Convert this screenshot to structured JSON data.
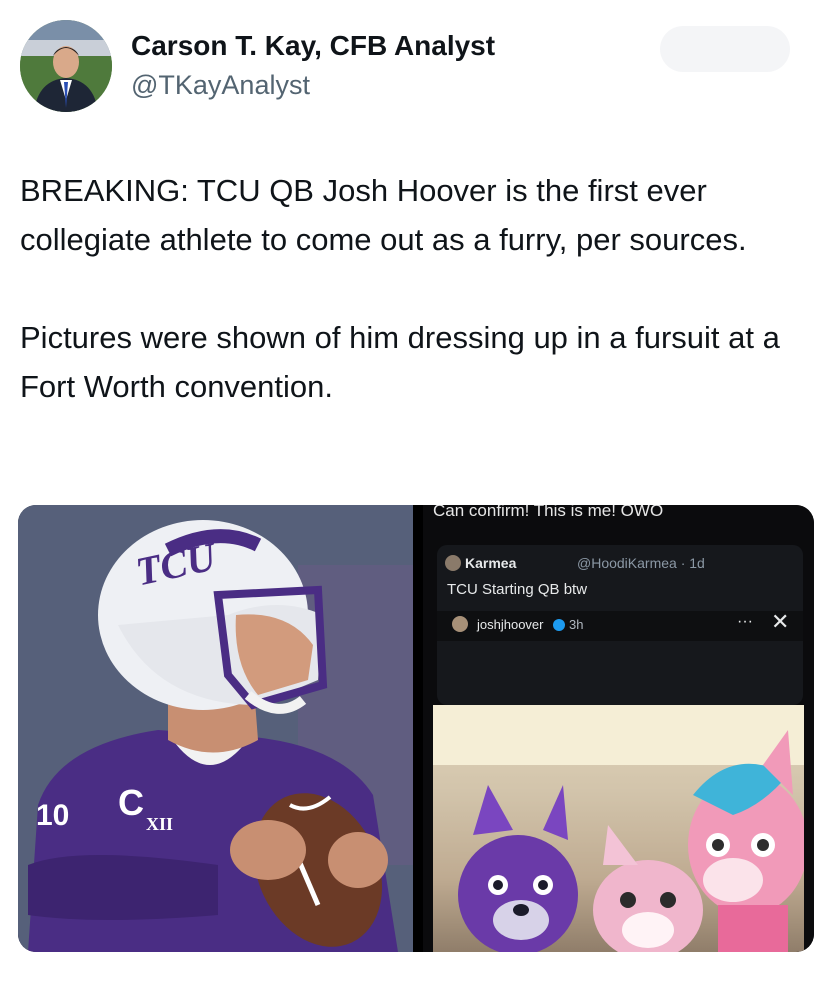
{
  "author": {
    "name": "Carson T. Kay, CFB Analyst",
    "handle": "@TKayAnalyst"
  },
  "tweet": {
    "paragraph1": "BREAKING: TCU QB Josh Hoover is the first ever collegiate athlete to come out as a furry, per sources.",
    "paragraph2": "Pictures were shown of him dressing up in a fursuit at a Fort Worth convention."
  },
  "media": {
    "left_image": {
      "helmet_text": "TCU",
      "jersey_letter": "C",
      "jersey_patch": "XII",
      "jersey_number_partial": "10"
    },
    "right_image": {
      "caption": "Can confirm! This is me! OWO",
      "quoted_author": "Karmea",
      "quoted_handle": "@HoodiKarmea · 1d",
      "quoted_text": "TCU Starting QB btw",
      "story_user": "joshjhoover",
      "story_time": "3h",
      "more_glyph": "···",
      "close_glyph": "✕"
    }
  }
}
